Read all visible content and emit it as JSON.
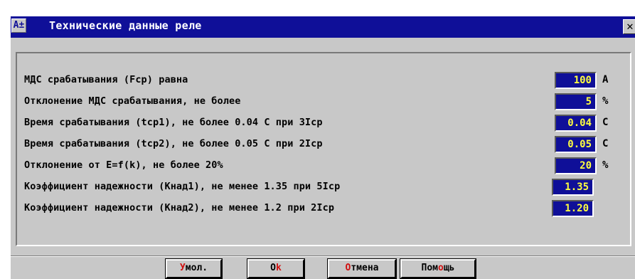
{
  "window": {
    "title": "Технические данные реле",
    "close_glyph": "✕",
    "icon_glyph": "A±"
  },
  "rows": [
    {
      "label": "МДС срабатывания (Fср) равна",
      "value": "100",
      "unit": "А"
    },
    {
      "label": "Отклонение МДС срабатывания, не более",
      "value": "5",
      "unit": "%"
    },
    {
      "label": "Время срабатывания (tср1), не более 0.04 С при 3Iср",
      "value": "0.04",
      "unit": "С"
    },
    {
      "label": "Время срабатывания (tср2), не более 0.05 С при 2Iср",
      "value": "0.05",
      "unit": "С"
    },
    {
      "label": "Отклонение от E=f(k), не более 20%",
      "value": "20",
      "unit": "%"
    },
    {
      "label": "Коэффициент надежности (Кнад1), не менее 1.35 при 5Iср",
      "value": "1.35",
      "unit": ""
    },
    {
      "label": "Коэффициент надежности (Кнад2), не менее 1.2 при 2Iср",
      "value": "1.20",
      "unit": ""
    }
  ],
  "buttons": {
    "default": {
      "hotkey": "У",
      "rest": "мол."
    },
    "ok": {
      "pre": "О",
      "hotkey": "k"
    },
    "cancel": {
      "hotkey": "О",
      "rest": "тмена"
    },
    "help": {
      "pre": "Пом",
      "hotkey": "о",
      "rest": "щь"
    }
  },
  "colors": {
    "title_bar": "#0f0f98",
    "field_bg": "#0f0f98",
    "field_text": "#ffff40",
    "hotkey": "#d01010",
    "window_bg": "#c8c8c8"
  }
}
